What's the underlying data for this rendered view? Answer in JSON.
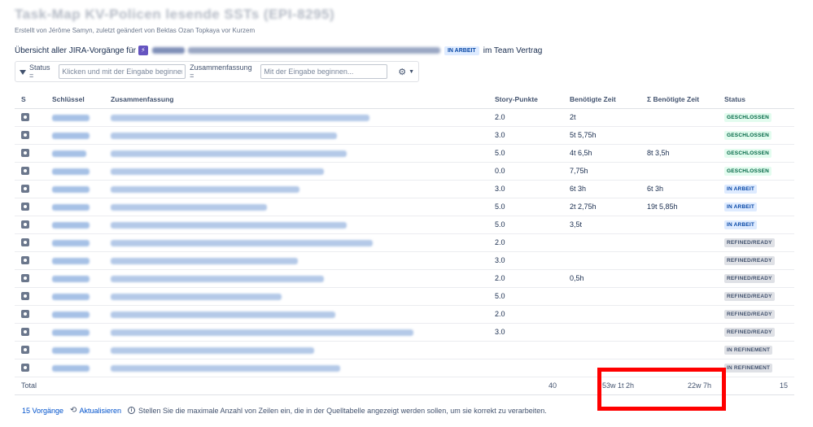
{
  "page": {
    "title": "Task-Map KV-Policen lesende SSTs (EPI-8295)",
    "byline": "Erstellt von Jérôme Samyn, zuletzt geändert von Bektas Ozan Topkaya vor Kurzem"
  },
  "overview": {
    "prefix": "Übersicht aller JIRA-Vorgänge für",
    "epic_icon": "epic-icon",
    "epic_key": "EPI-8295",
    "epic_name": "KV-Policen lesende SSTs",
    "status": "IN ARBEIT",
    "suffix": "im Team Vertrag"
  },
  "filters": {
    "status_label": "Status =",
    "status_placeholder": "Klicken und mit der Eingabe beginnen...",
    "summary_label": "Zusammenfassung =",
    "summary_placeholder": "Mit der Eingabe beginnen...",
    "settings_icon": "gear-icon"
  },
  "table": {
    "headers": [
      "S",
      "Schlüssel",
      "Zusammenfassung",
      "Story-Punkte",
      "Benötigte Zeit",
      "Σ Benötigte Zeit",
      "Status"
    ],
    "rows": [
      {
        "key": "EPI-8301",
        "summary": "[Backend] SST Vertrag lesen",
        "points": "2.0",
        "time": "2t",
        "sum_time": "",
        "status": "GESCHLOSSEN",
        "status_color": "green"
      },
      {
        "key": "EPI-8302",
        "summary": "[Backend] SST Vertrag lesen",
        "points": "3.0",
        "time": "5t 5,75h",
        "sum_time": "",
        "status": "GESCHLOSSEN",
        "status_color": "green"
      },
      {
        "key": "EPI-8303",
        "summary": "[Backend] SST Vertrag lesen",
        "points": "5.0",
        "time": "4t 6,5h",
        "sum_time": "8t 3,5h",
        "status": "GESCHLOSSEN",
        "status_color": "green"
      },
      {
        "key": "EPI-8304",
        "summary": "[Backend] SST Vertrag lesen",
        "points": "0.0",
        "time": "7,75h",
        "sum_time": "",
        "status": "GESCHLOSSEN",
        "status_color": "green"
      },
      {
        "key": "EPI-8305",
        "summary": "[Backend] SST Vertrag lesen",
        "points": "3.0",
        "time": "6t 3h",
        "sum_time": "6t 3h",
        "status": "IN ARBEIT",
        "status_color": "blue"
      },
      {
        "key": "EPI-8306",
        "summary": "[Backend] SST Vertrag lesen",
        "points": "5.0",
        "time": "2t 2,75h",
        "sum_time": "19t 5,85h",
        "status": "IN ARBEIT",
        "status_color": "blue"
      },
      {
        "key": "EPI-8307",
        "summary": "[Backend] SST Vertrag lesen",
        "points": "5.0",
        "time": "3,5t",
        "sum_time": "",
        "status": "IN ARBEIT",
        "status_color": "blue"
      },
      {
        "key": "EPI-8308",
        "summary": "[Backend] SST Vertrag lesen",
        "points": "2.0",
        "time": "",
        "sum_time": "",
        "status": "REFINED/READY",
        "status_color": "grey"
      },
      {
        "key": "EPI-8309",
        "summary": "[Backend] SST Vertrag lesen",
        "points": "3.0",
        "time": "",
        "sum_time": "",
        "status": "REFINED/READY",
        "status_color": "grey"
      },
      {
        "key": "EPI-8310",
        "summary": "[Backend] SST Vertrag lesen",
        "points": "2.0",
        "time": "0,5h",
        "sum_time": "",
        "status": "REFINED/READY",
        "status_color": "grey"
      },
      {
        "key": "EPI-8311",
        "summary": "[Backend] SST Vertrag lesen",
        "points": "5.0",
        "time": "",
        "sum_time": "",
        "status": "REFINED/READY",
        "status_color": "grey"
      },
      {
        "key": "EPI-8312",
        "summary": "[Backend] SST Vertrag lesen",
        "points": "2.0",
        "time": "",
        "sum_time": "",
        "status": "REFINED/READY",
        "status_color": "grey"
      },
      {
        "key": "EPI-8313",
        "summary": "[Backend] SST Vertrag lesen",
        "points": "3.0",
        "time": "",
        "sum_time": "",
        "status": "REFINED/READY",
        "status_color": "grey"
      },
      {
        "key": "EPI-8314",
        "summary": "[Backend] SST Vertrag lesen",
        "points": "",
        "time": "",
        "sum_time": "",
        "status": "IN REFINEMENT",
        "status_color": "grey"
      },
      {
        "key": "EPI-8315",
        "summary": "[Backend] SST Vertrag lesen",
        "points": "",
        "time": "",
        "sum_time": "",
        "status": "IN REFINEMENT",
        "status_color": "grey"
      }
    ],
    "total": {
      "label": "Total",
      "points": "40",
      "time": "53w 1t 2h",
      "sum_time": "22w 7h",
      "count": "15"
    }
  },
  "footer": {
    "count": "15 Vorgänge",
    "refresh_icon": "refresh-icon",
    "refresh": "Aktualisieren",
    "info_icon": "info-icon",
    "info": "Stellen Sie die maximale Anzahl von Zeilen ein, die in der Quelltabelle angezeigt werden sollen, um sie korrekt zu verarbeiten."
  },
  "colors": {
    "link": "#0052cc",
    "highlight": "#ff0000",
    "status_green_bg": "#e3fcef",
    "status_blue_bg": "#deebff",
    "status_grey_bg": "#dfe1e6"
  }
}
